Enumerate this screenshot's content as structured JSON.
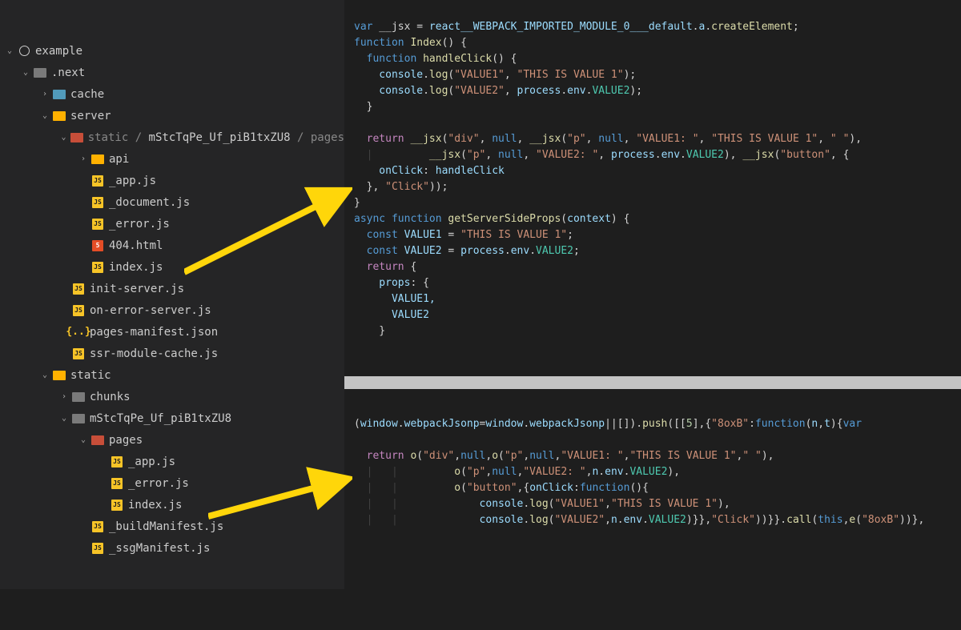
{
  "tree": {
    "root": "example",
    "next": ".next",
    "cache": "cache",
    "server": "server",
    "static_path_pre": "static / ",
    "static_hash": "mStcTqPe_Uf_piB1txZU8",
    "static_path_post": " / pages",
    "api": "api",
    "app": "_app.js",
    "doc": "_document.js",
    "err": "_error.js",
    "fof": "404.html",
    "idx": "index.js",
    "initserver": "init-server.js",
    "onerror": "on-error-server.js",
    "manifest": "pages-manifest.json",
    "ssr": "ssr-module-cache.js",
    "static": "static",
    "chunks": "chunks",
    "hashdir": "mStcTqPe_Uf_piB1txZU8",
    "pages": "pages",
    "app2": "_app.js",
    "err2": "_error.js",
    "idx2": "index.js",
    "build": "_buildManifest.js",
    "ssg": "_ssgManifest.js",
    "js_label": "JS",
    "html5_label": "5"
  },
  "code": {
    "l1a": "var",
    "l1b": " __jsx ",
    "l1c": "=",
    "l1d": " react__WEBPACK_IMPORTED_MODULE_0___default",
    "l1e": ".",
    "l1f": "a",
    "l1g": ".",
    "l1h": "createElement",
    "l1i": ";",
    "l2a": "function",
    "l2b": " Index",
    "l2c": "() {",
    "l3a": "  function",
    "l3b": " handleClick",
    "l3c": "() {",
    "l4a": "    console",
    "l4b": ".",
    "l4c": "log",
    "l4d": "(",
    "l4e": "\"VALUE1\"",
    "l4f": ", ",
    "l4g": "\"THIS IS VALUE 1\"",
    "l4h": ");",
    "l5a": "    console",
    "l5b": ".",
    "l5c": "log",
    "l5d": "(",
    "l5e": "\"VALUE2\"",
    "l5f": ", ",
    "l5g": "process",
    "l5h": ".",
    "l5i": "env",
    "l5j": ".",
    "l5k": "VALUE2",
    "l5l": ");",
    "l6": "  }",
    "l8a": "  return",
    "l8b": " __jsx",
    "l8c": "(",
    "l8d": "\"div\"",
    "l8e": ", ",
    "l8f": "null",
    "l8g": ", ",
    "l8h": "__jsx",
    "l8i": "(",
    "l8j": "\"p\"",
    "l8k": ", ",
    "l8l": "null",
    "l8m": ", ",
    "l8n": "\"VALUE1: \"",
    "l8o": ", ",
    "l8p": "\"THIS IS VALUE 1\"",
    "l8q": ", ",
    "l8r": "\" \"",
    "l8s": "),",
    "l9a": "      __jsx",
    "l9b": "(",
    "l9c": "\"p\"",
    "l9d": ", ",
    "l9e": "null",
    "l9f": ", ",
    "l9g": "\"VALUE2: \"",
    "l9h": ", ",
    "l9i": "process",
    "l9j": ".",
    "l9k": "env",
    "l9l": ".",
    "l9m": "VALUE2",
    "l9n": "), ",
    "l9o": "__jsx",
    "l9p": "(",
    "l9q": "\"button\"",
    "l9r": ", {",
    "l10a": "    onClick",
    "l10b": ": ",
    "l10c": "handleClick",
    "l11a": "  }, ",
    "l11b": "\"Click\"",
    "l11c": "));",
    "l12": "}",
    "l13a": "async function",
    "l13b": " getServerSideProps",
    "l13c": "(",
    "l13d": "context",
    "l13e": ") {",
    "l14a": "  const",
    "l14b": " VALUE1 ",
    "l14c": "= ",
    "l14d": "\"THIS IS VALUE 1\"",
    "l14e": ";",
    "l15a": "  const",
    "l15b": " VALUE2 ",
    "l15c": "= ",
    "l15d": "process",
    "l15e": ".",
    "l15f": "env",
    "l15g": ".",
    "l15h": "VALUE2",
    "l15i": ";",
    "l16a": "  return",
    "l16b": " {",
    "l17a": "    props",
    "l17b": ": {",
    "l18": "      VALUE1,",
    "l19": "      VALUE2",
    "l20": "    }",
    "b1a": "(",
    "b1b": "window",
    "b1c": ".",
    "b1d": "webpackJsonp",
    "b1e": "=",
    "b1f": "window",
    "b1g": ".",
    "b1h": "webpackJsonp",
    "b1i": "||[]).",
    "b1j": "push",
    "b1k": "([[",
    "b1l": "5",
    "b1m": "],{",
    "b1n": "\"8oxB\"",
    "b1o": ":",
    "b1p": "function",
    "b1q": "(",
    "b1r": "n",
    "b1s": ",",
    "b1t": "t",
    "b1u": "){",
    "b1v": "var",
    "b3a": "  return",
    "b3b": " o",
    "b3c": "(",
    "b3d": "\"div\"",
    "b3e": ",",
    "b3f": "null",
    "b3g": ",",
    "b3h": "o",
    "b3i": "(",
    "b3j": "\"p\"",
    "b3k": ",",
    "b3l": "null",
    "b3m": ",",
    "b3n": "\"VALUE1: \"",
    "b3o": ",",
    "b3p": "\"THIS IS VALUE 1\"",
    "b3q": ",",
    "b3r": "\" \"",
    "b3s": "),",
    "b4a": "        o",
    "b4b": "(",
    "b4c": "\"p\"",
    "b4d": ",",
    "b4e": "null",
    "b4f": ",",
    "b4g": "\"VALUE2: \"",
    "b4h": ",",
    "b4i": "n",
    "b4j": ".",
    "b4k": "env",
    "b4l": ".",
    "b4m": "VALUE2",
    "b4n": "),",
    "b5a": "        o",
    "b5b": "(",
    "b5c": "\"button\"",
    "b5d": ",{",
    "b5e": "onClick",
    "b5f": ":",
    "b5g": "function",
    "b5h": "(){",
    "b6a": "          console",
    "b6b": ".",
    "b6c": "log",
    "b6d": "(",
    "b6e": "\"VALUE1\"",
    "b6f": ",",
    "b6g": "\"THIS IS VALUE 1\"",
    "b6h": "),",
    "b7a": "          console",
    "b7b": ".",
    "b7c": "log",
    "b7d": "(",
    "b7e": "\"VALUE2\"",
    "b7f": ",",
    "b7g": "n",
    "b7h": ".",
    "b7i": "env",
    "b7j": ".",
    "b7k": "VALUE2",
    "b7l": ")}},",
    "b7m": "\"Click\"",
    "b7n": "))}}.",
    "b7o": "call",
    "b7p": "(",
    "b7q": "this",
    "b7r": ",",
    "b7s": "e",
    "b7t": "(",
    "b7u": "\"8oxB\"",
    "b7v": "))},"
  }
}
